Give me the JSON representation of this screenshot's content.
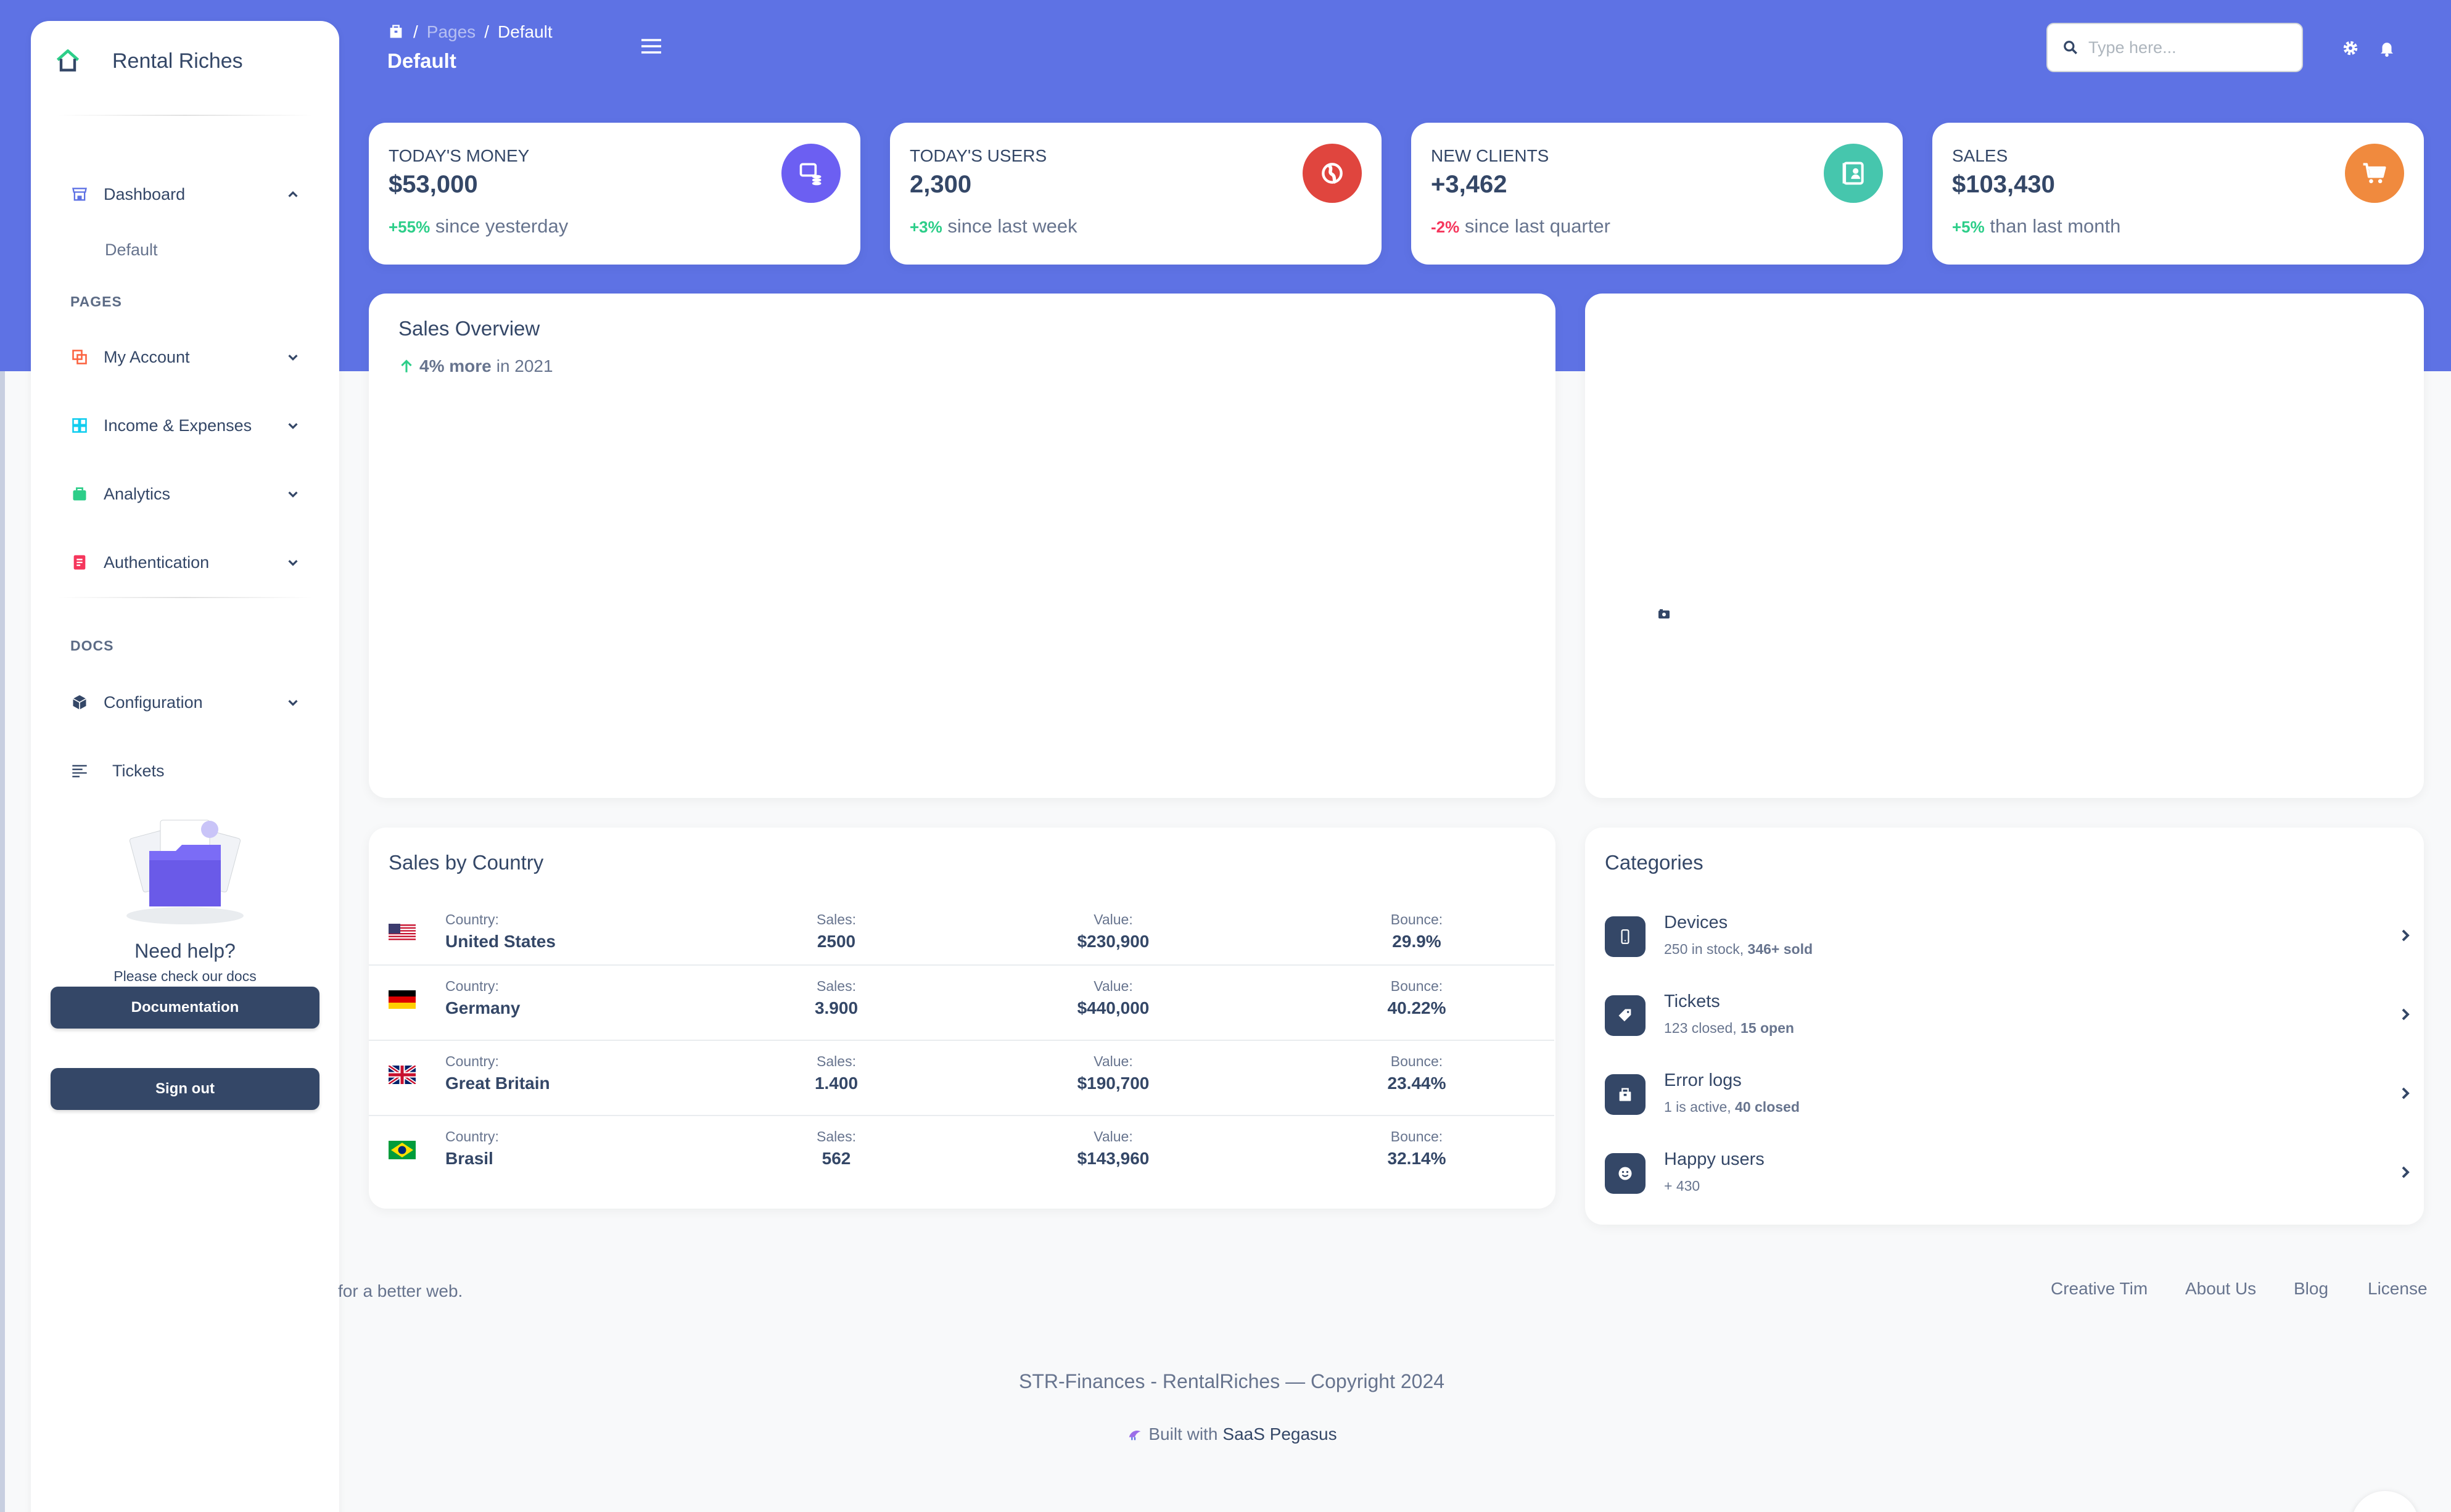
{
  "brand": {
    "name": "Rental Riches"
  },
  "sidebar": {
    "dashboard": {
      "label": "Dashboard",
      "sub": "Default"
    },
    "pages_heading": "PAGES",
    "items": [
      {
        "label": "My Account",
        "icon": "account-icon",
        "color": "#fb6340"
      },
      {
        "label": "Income & Expenses",
        "icon": "grid-icon",
        "color": "#11cdef"
      },
      {
        "label": "Analytics",
        "icon": "bag-icon",
        "color": "#2dce89"
      },
      {
        "label": "Authentication",
        "icon": "document-icon",
        "color": "#f5365c"
      }
    ],
    "docs_heading": "DOCS",
    "configuration": "Configuration",
    "tickets": "Tickets",
    "help": {
      "title": "Need help?",
      "subtitle": "Please check our docs",
      "button": "Documentation"
    },
    "signout": "Sign out"
  },
  "header": {
    "breadcrumb": [
      "Pages",
      "Default"
    ],
    "title": "Default",
    "search_placeholder": "Type here..."
  },
  "stats": [
    {
      "label": "TODAY'S MONEY",
      "value": "$53,000",
      "change": "+55%",
      "change_text": "since yesterday",
      "change_type": "pos",
      "color": "#6c5ff2",
      "icon": "money-icon"
    },
    {
      "label": "TODAY'S USERS",
      "value": "2,300",
      "change": "+3%",
      "change_text": "since last week",
      "change_type": "pos",
      "color": "#e0453e",
      "icon": "globe-icon"
    },
    {
      "label": "NEW CLIENTS",
      "value": "+3,462",
      "change": "-2%",
      "change_text": "since last quarter",
      "change_type": "neg",
      "color": "#46c6ad",
      "icon": "client-icon"
    },
    {
      "label": "SALES",
      "value": "$103,430",
      "change": "+5%",
      "change_text": "than last month",
      "change_type": "pos",
      "color": "#f08a3e",
      "icon": "cart-icon"
    }
  ],
  "sales_overview": {
    "title": "Sales Overview",
    "change": "4% more",
    "period": "in 2021"
  },
  "sales_by_country": {
    "title": "Sales by Country",
    "headers": {
      "country": "Country:",
      "sales": "Sales:",
      "value": "Value:",
      "bounce": "Bounce:"
    },
    "rows": [
      {
        "country": "United States",
        "sales": "2500",
        "value": "$230,900",
        "bounce": "29.9%",
        "flag": "us-flag-icon"
      },
      {
        "country": "Germany",
        "sales": "3.900",
        "value": "$440,000",
        "bounce": "40.22%",
        "flag": "de-flag-icon"
      },
      {
        "country": "Great Britain",
        "sales": "1.400",
        "value": "$190,700",
        "bounce": "23.44%",
        "flag": "gb-flag-icon"
      },
      {
        "country": "Brasil",
        "sales": "562",
        "value": "$143,960",
        "bounce": "32.14%",
        "flag": "br-flag-icon"
      }
    ]
  },
  "categories": {
    "title": "Categories",
    "items": [
      {
        "name": "Devices",
        "desc": "250 in stock,",
        "strong": "346+ sold",
        "icon": "mobile-icon"
      },
      {
        "name": "Tickets",
        "desc": "123 closed,",
        "strong": "15 open",
        "icon": "tag-icon"
      },
      {
        "name": "Error logs",
        "desc": "1 is active,",
        "strong": "40 closed",
        "icon": "box-icon"
      },
      {
        "name": "Happy users",
        "desc": "+ 430",
        "strong": "",
        "icon": "smile-icon"
      }
    ]
  },
  "footer": {
    "left": "for a better web.",
    "links": [
      "Creative Tim",
      "About Us",
      "Blog",
      "License"
    ],
    "copyright": "STR-Finances - RentalRiches — Copyright 2024",
    "built_prefix": "Built with",
    "built_link": "SaaS Pegasus"
  }
}
